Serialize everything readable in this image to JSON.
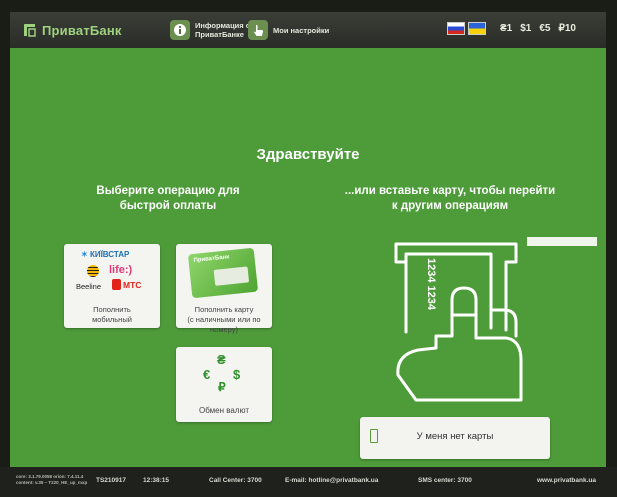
{
  "topbar": {
    "logo_text": "ПриватБанк",
    "info_label": "Информация о\nПриватБанке",
    "settings_label": "Мои настройки",
    "denominations": [
      "₴1",
      "$1",
      "€5",
      "₽10"
    ]
  },
  "main": {
    "greeting": "Здравствуйте",
    "left_title": "Выберите операцию для\nбыстрой оплаты",
    "right_title": "...или вставьте карту, чтобы перейти\nк другим операциям",
    "tiles": {
      "mobile": {
        "brands": [
          "КИЇВСТАР",
          "life:)",
          "Beeline",
          "МТС"
        ],
        "caption": "Пополнить\nмобильный"
      },
      "card": {
        "logo": "ПриватБанк",
        "caption": "Пополнить карту\n(с наличными или по номеру)"
      },
      "exchange": {
        "caption": "Обмен валют"
      }
    },
    "card_number": "1234 1234",
    "no_card_button": "У меня нет карты"
  },
  "bottombar": {
    "version_info": "core: 3.1.79.0058  orion: 7.4.11.4\ncontent: v.35 – T220_HE_up_mxp",
    "terminal_id": "TS210917",
    "time": "12:38:15",
    "call_center": "Call Center: 3700",
    "email": "E-mail: hotline@privatbank.ua",
    "sms_center": "SMS center: 3700",
    "website": "www.privatbank.ua"
  },
  "colors": {
    "screen_green": "#4e9b3a",
    "topbar": "#2e312b",
    "logo_green": "#9fd27f",
    "tile_bg": "#f4f4f1"
  }
}
